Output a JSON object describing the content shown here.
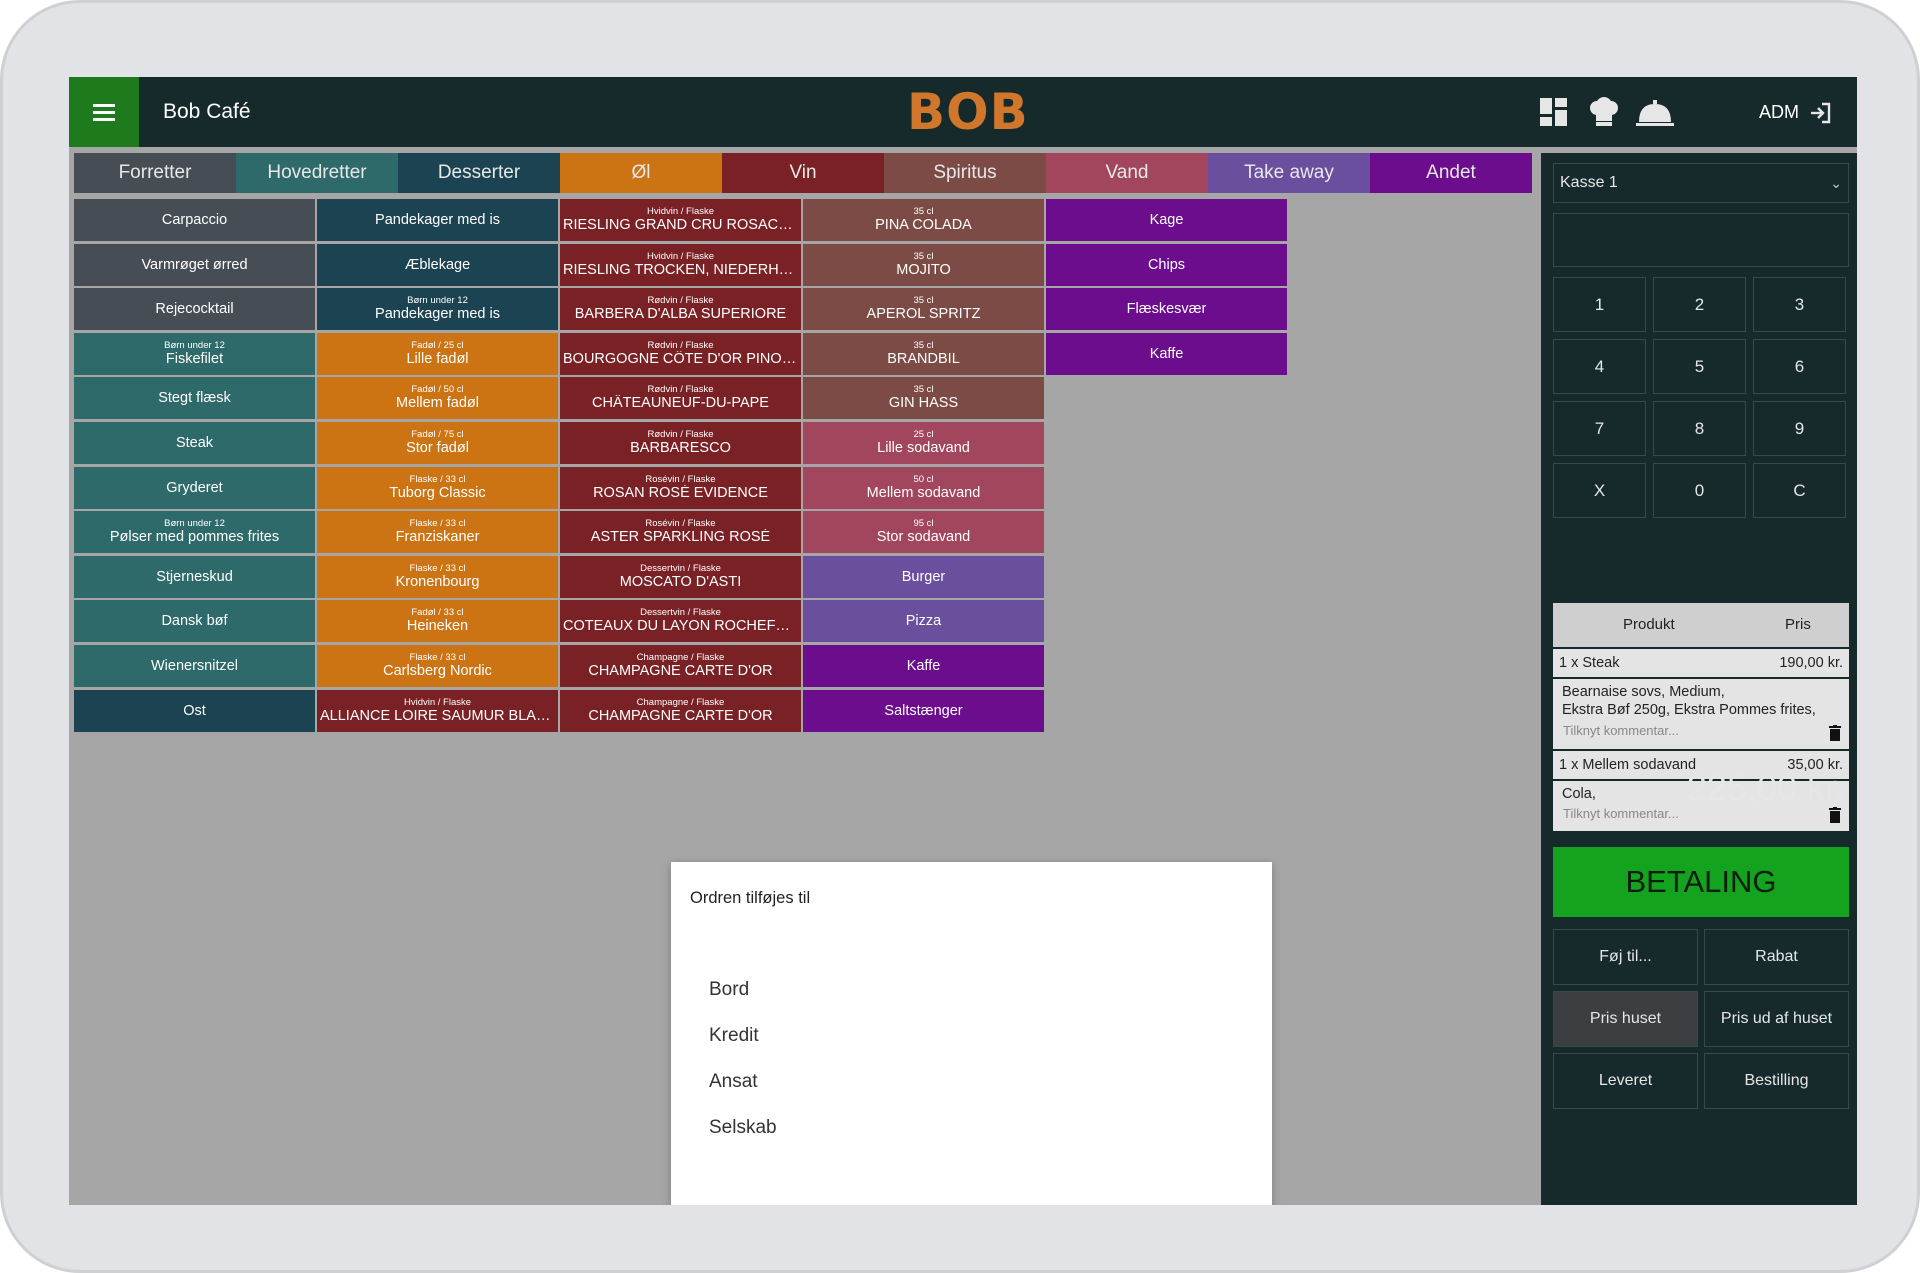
{
  "header": {
    "app_title": "Bob Café",
    "logo_text": "BOB",
    "adm_label": "ADM"
  },
  "tabs": [
    {
      "label": "Forretter",
      "color": "#474d55"
    },
    {
      "label": "Hovedretter",
      "color": "#2e6a6a"
    },
    {
      "label": "Desserter",
      "color": "#1b4352"
    },
    {
      "label": "Øl",
      "color": "#cc7314"
    },
    {
      "label": "Vin",
      "color": "#7a2125"
    },
    {
      "label": "Spiritus",
      "color": "#7c4b45"
    },
    {
      "label": "Vand",
      "color": "#a1465c"
    },
    {
      "label": "Take away",
      "color": "#6a4f9f"
    },
    {
      "label": "Andet",
      "color": "#6b0d8c"
    }
  ],
  "columns": [
    [
      {
        "sub": "",
        "label": "Carpaccio",
        "cat": 0
      },
      {
        "sub": "",
        "label": "Varmrøget ørred",
        "cat": 0
      },
      {
        "sub": "",
        "label": "Rejecocktail",
        "cat": 0
      },
      {
        "sub": "Børn under 12",
        "label": "Fiskefilet",
        "cat": 1
      },
      {
        "sub": "",
        "label": "Stegt flæsk",
        "cat": 1
      },
      {
        "sub": "",
        "label": "Steak",
        "cat": 1
      },
      {
        "sub": "",
        "label": "Gryderet",
        "cat": 1
      },
      {
        "sub": "Børn under 12",
        "label": "Pølser med pommes frites",
        "cat": 1
      },
      {
        "sub": "",
        "label": "Stjerneskud",
        "cat": 1
      },
      {
        "sub": "",
        "label": "Dansk bøf",
        "cat": 1
      },
      {
        "sub": "",
        "label": "Wienersnitzel",
        "cat": 1
      },
      {
        "sub": "",
        "label": "Ost",
        "cat": 2
      }
    ],
    [
      {
        "sub": "",
        "label": "Pandekager med is",
        "cat": 2
      },
      {
        "sub": "",
        "label": "Æblekage",
        "cat": 2
      },
      {
        "sub": "Børn under 12",
        "label": "Pandekager med is",
        "cat": 2
      },
      {
        "sub": "Fadøl / 25 cl",
        "label": "Lille fadøl",
        "cat": 3
      },
      {
        "sub": "Fadøl / 50 cl",
        "label": "Mellem fadøl",
        "cat": 3
      },
      {
        "sub": "Fadøl / 75 cl",
        "label": "Stor fadøl",
        "cat": 3
      },
      {
        "sub": "Flaske / 33 cl",
        "label": "Tuborg Classic",
        "cat": 3
      },
      {
        "sub": "Flaske / 33 cl",
        "label": "Franziskaner",
        "cat": 3
      },
      {
        "sub": "Flaske / 33 cl",
        "label": "Kronenbourg",
        "cat": 3
      },
      {
        "sub": "Fadøl / 33 cl",
        "label": "Heineken",
        "cat": 3
      },
      {
        "sub": "Flaske / 33 cl",
        "label": "Carlsberg Nordic",
        "cat": 3
      },
      {
        "sub": "Hvidvin / Flaske",
        "label": "ALLIANCE LOIRE SAUMUR BLANC",
        "cat": 4
      }
    ],
    [
      {
        "sub": "Hvidvin / Flaske",
        "label": "RIESLING GRAND CRU ROSACKER",
        "cat": 4
      },
      {
        "sub": "Hvidvin / Flaske",
        "label": "RIESLING TROCKEN, NIEDERHÄ...",
        "cat": 4
      },
      {
        "sub": "Rødvin / Flaske",
        "label": "BARBERA D'ALBA SUPERIORE",
        "cat": 4
      },
      {
        "sub": "Rødvin / Flaske",
        "label": "BOURGOGNE CÔTE D'OR PINOT ...",
        "cat": 4
      },
      {
        "sub": "Rødvin / Flaske",
        "label": "CHÂTEAUNEUF-DU-PAPE",
        "cat": 4
      },
      {
        "sub": "Rødvin / Flaske",
        "label": "BARBARESCO",
        "cat": 4
      },
      {
        "sub": "Rosévin / Flaske",
        "label": "ROSAN ROSÉ EVIDENCE",
        "cat": 4
      },
      {
        "sub": "Rosévin / Flaske",
        "label": "ASTER SPARKLING ROSÉ",
        "cat": 4
      },
      {
        "sub": "Dessertvin / Flaske",
        "label": "MOSCATO D'ASTI",
        "cat": 4
      },
      {
        "sub": "Dessertvin / Flaske",
        "label": "COTEAUX DU LAYON ROCHEFORT",
        "cat": 4
      },
      {
        "sub": "Champagne / Flaske",
        "label": "CHAMPAGNE CARTE D'OR",
        "cat": 4
      },
      {
        "sub": "Champagne / Flaske",
        "label": "CHAMPAGNE CARTE D'OR",
        "cat": 4
      }
    ],
    [
      {
        "sub": "35 cl",
        "label": "PINA COLADA",
        "cat": 5
      },
      {
        "sub": "35 cl",
        "label": "MOJITO",
        "cat": 5
      },
      {
        "sub": "35 cl",
        "label": "APEROL SPRITZ",
        "cat": 5
      },
      {
        "sub": "35 cl",
        "label": "BRANDBIL",
        "cat": 5
      },
      {
        "sub": "35 cl",
        "label": "GIN HASS",
        "cat": 5
      },
      {
        "sub": "25 cl",
        "label": "Lille sodavand",
        "cat": 6
      },
      {
        "sub": "50 cl",
        "label": "Mellem sodavand",
        "cat": 6
      },
      {
        "sub": "95 cl",
        "label": "Stor sodavand",
        "cat": 6
      },
      {
        "sub": "",
        "label": "Burger",
        "cat": 7
      },
      {
        "sub": "",
        "label": "Pizza",
        "cat": 7
      },
      {
        "sub": "",
        "label": "Kaffe",
        "cat": 8
      },
      {
        "sub": "",
        "label": "Saltstænger",
        "cat": 8
      }
    ],
    [
      {
        "sub": "",
        "label": "Kage",
        "cat": 8
      },
      {
        "sub": "",
        "label": "Chips",
        "cat": 8
      },
      {
        "sub": "",
        "label": "Flæskesvær",
        "cat": 8
      },
      {
        "sub": "",
        "label": "Kaffe",
        "cat": 8
      }
    ]
  ],
  "dialog": {
    "title": "Ordren tilføjes til",
    "options": [
      "Bord",
      "Kredit",
      "Ansat",
      "Selskab"
    ]
  },
  "sidebar": {
    "register": "Kasse 1",
    "display_value": "",
    "keypad": [
      "1",
      "2",
      "3",
      "4",
      "5",
      "6",
      "7",
      "8",
      "9",
      "X",
      "0",
      "C"
    ],
    "order_header": {
      "product": "Produkt",
      "price": "Pris"
    },
    "lines": [
      {
        "qty_name": "1 x Steak",
        "price": "190,00 kr.",
        "details": [
          "Bearnaise sovs, Medium,",
          "Ekstra Bøf 250g, Ekstra Pommes frites,"
        ],
        "comment_placeholder": "Tilknyt kommentar..."
      },
      {
        "qty_name": "1 x Mellem sodavand",
        "price": "35,00 kr.",
        "details": [
          "Cola,"
        ],
        "comment_placeholder": "Tilknyt kommentar..."
      }
    ],
    "total": "225,00 kr.",
    "pay_label": "BETALING",
    "actions": [
      "Føj til...",
      "Rabat",
      "Pris huset",
      "Pris ud af huset",
      "Leveret",
      "Bestilling"
    ]
  }
}
